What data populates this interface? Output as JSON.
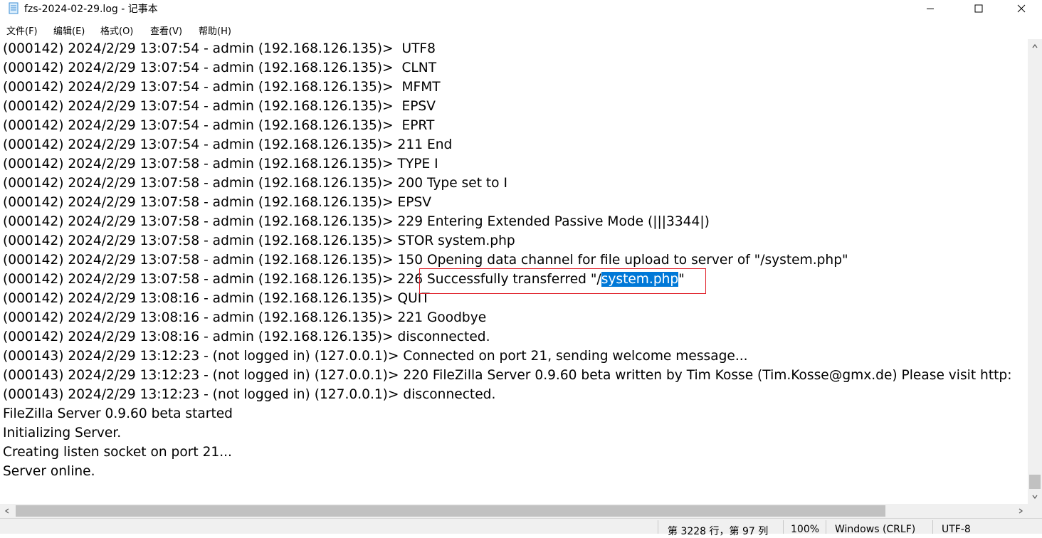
{
  "window": {
    "title": "fzs-2024-02-29.log - 记事本",
    "file_icon": "notepad-document-icon"
  },
  "menu": [
    {
      "label": "文件(F)"
    },
    {
      "label": "编辑(E)"
    },
    {
      "label": "格式(O)"
    },
    {
      "label": "查看(V)"
    },
    {
      "label": "帮助(H)"
    }
  ],
  "content": {
    "lines": [
      "(000142) 2024/2/29 13:07:54 - admin (192.168.126.135)>  UTF8",
      "(000142) 2024/2/29 13:07:54 - admin (192.168.126.135)>  CLNT",
      "(000142) 2024/2/29 13:07:54 - admin (192.168.126.135)>  MFMT",
      "(000142) 2024/2/29 13:07:54 - admin (192.168.126.135)>  EPSV",
      "(000142) 2024/2/29 13:07:54 - admin (192.168.126.135)>  EPRT",
      "(000142) 2024/2/29 13:07:54 - admin (192.168.126.135)> 211 End",
      "(000142) 2024/2/29 13:07:58 - admin (192.168.126.135)> TYPE I",
      "(000142) 2024/2/29 13:07:58 - admin (192.168.126.135)> 200 Type set to I",
      "(000142) 2024/2/29 13:07:58 - admin (192.168.126.135)> EPSV",
      "(000142) 2024/2/29 13:07:58 - admin (192.168.126.135)> 229 Entering Extended Passive Mode (|||3344|)",
      "(000142) 2024/2/29 13:07:58 - admin (192.168.126.135)> STOR system.php",
      "(000142) 2024/2/29 13:07:58 - admin (192.168.126.135)> 150 Opening data channel for file upload to server of \"/system.php\"",
      "",
      "(000142) 2024/2/29 13:08:16 - admin (192.168.126.135)> QUIT",
      "(000142) 2024/2/29 13:08:16 - admin (192.168.126.135)> 221 Goodbye",
      "(000142) 2024/2/29 13:08:16 - admin (192.168.126.135)> disconnected.",
      "(000143) 2024/2/29 13:12:23 - (not logged in) (127.0.0.1)> Connected on port 21, sending welcome message...",
      "(000143) 2024/2/29 13:12:23 - (not logged in) (127.0.0.1)> 220 FileZilla Server 0.9.60 beta written by Tim Kosse (Tim.Kosse@gmx.de) Please visit http:",
      "(000143) 2024/2/29 13:12:23 - (not logged in) (127.0.0.1)> disconnected.",
      "FileZilla Server 0.9.60 beta started",
      "Initializing Server.",
      "Creating listen socket on port 21...",
      "Server online."
    ],
    "selected_line": {
      "before": "(000142) 2024/2/29 13:07:58 - admin (192.168.126.135)> 226 Successfully transferred \"/",
      "selected": "system.php",
      "after": "\""
    }
  },
  "status": {
    "position": "第 3228 行，第 97 列",
    "zoom": "100%",
    "line_ending": "Windows (CRLF)",
    "encoding": "UTF-8"
  },
  "colors": {
    "selection": "#0078d7",
    "annotation_box": "#e0202a"
  }
}
